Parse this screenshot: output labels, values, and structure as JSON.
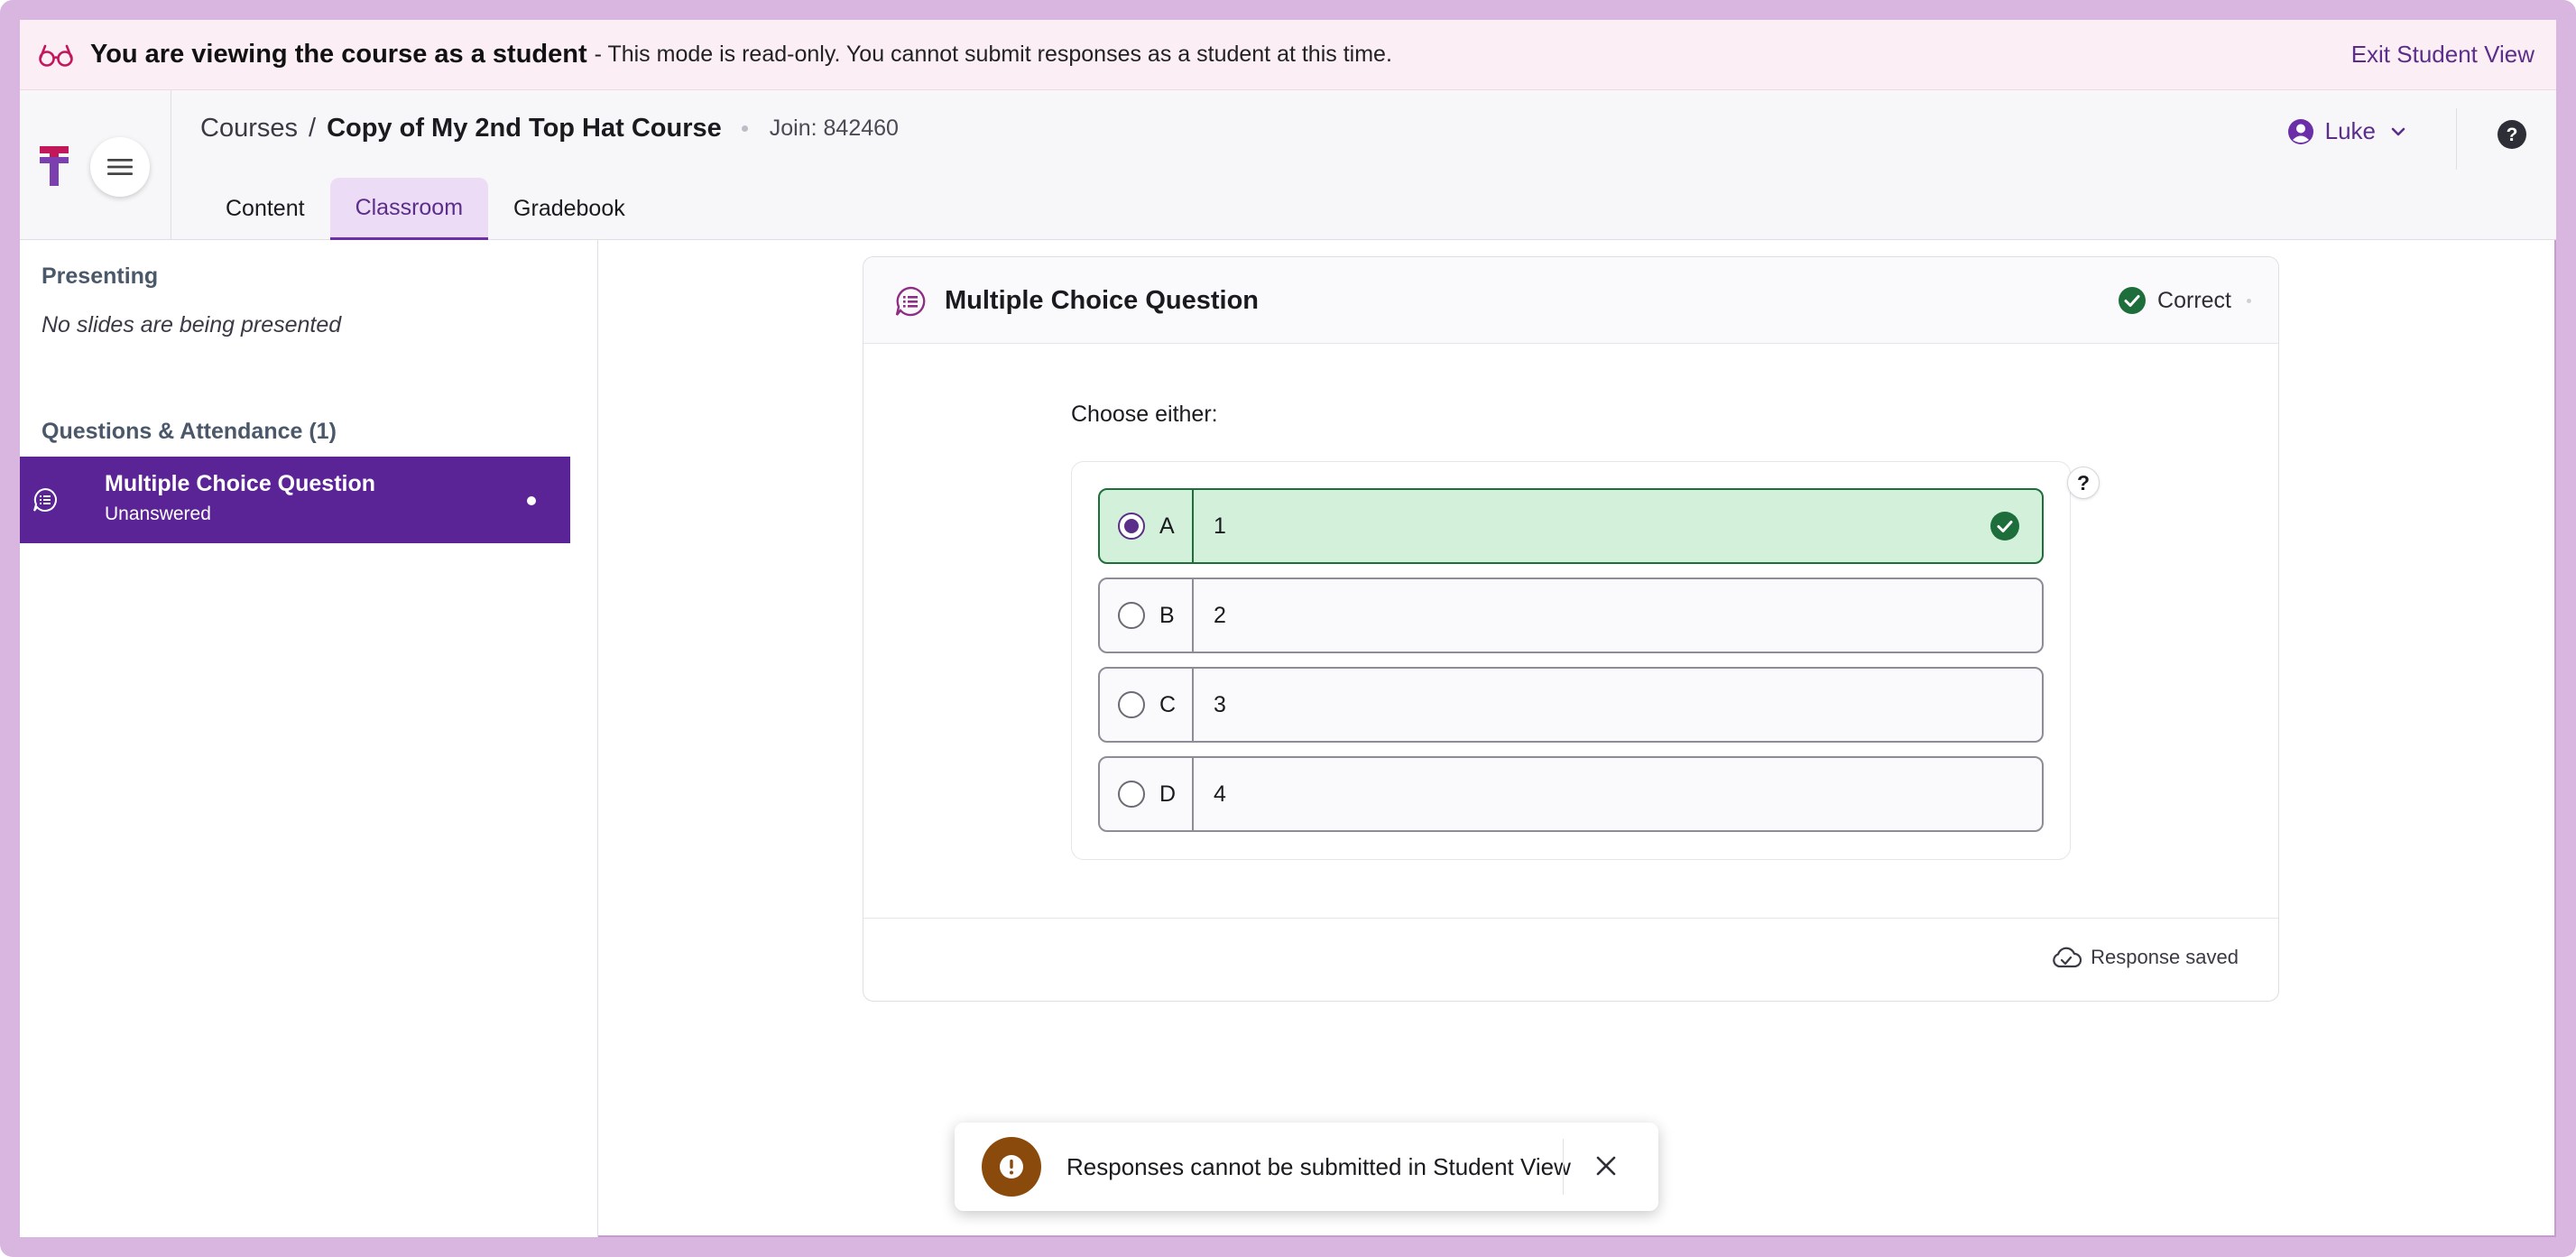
{
  "banner": {
    "title": "You are viewing the course as a student",
    "description": "- This mode is read-only. You cannot submit responses as a student at this time.",
    "exit_label": "Exit Student View"
  },
  "header": {
    "breadcrumb_courses": "Courses",
    "breadcrumb_sep": "/",
    "course_name": "Copy of My 2nd Top Hat Course",
    "join_code": "Join: 842460",
    "tabs": [
      {
        "label": "Content",
        "active": false
      },
      {
        "label": "Classroom",
        "active": true
      },
      {
        "label": "Gradebook",
        "active": false
      }
    ],
    "user_name": "Luke"
  },
  "sidebar": {
    "presenting_heading": "Presenting",
    "presenting_empty": "No slides are being presented",
    "questions_heading": "Questions & Attendance (1)",
    "items": [
      {
        "title": "Multiple Choice Question",
        "status": "Unanswered"
      }
    ]
  },
  "question": {
    "type_label": "Multiple Choice Question",
    "result": "Correct",
    "prompt": "Choose either:",
    "help": "?",
    "options": [
      {
        "letter": "A",
        "value": "1",
        "selected": true,
        "correct": true
      },
      {
        "letter": "B",
        "value": "2",
        "selected": false,
        "correct": false
      },
      {
        "letter": "C",
        "value": "3",
        "selected": false,
        "correct": false
      },
      {
        "letter": "D",
        "value": "4",
        "selected": false,
        "correct": false
      }
    ],
    "saved_label": "Response saved"
  },
  "toast": {
    "message": "Responses cannot be submitted in Student View"
  },
  "colors": {
    "accent": "#5b2496",
    "banner_bg": "#fbeef5",
    "correct_bg": "#d2f0da",
    "correct_border": "#1e6e3c",
    "warning": "#8a4a0b"
  }
}
